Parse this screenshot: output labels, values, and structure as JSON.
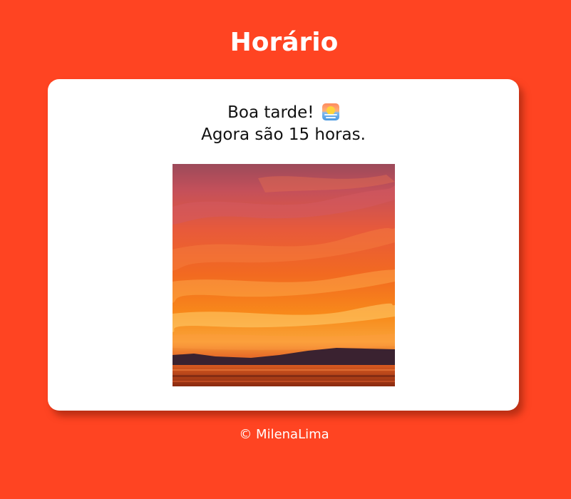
{
  "header": {
    "title": "Horário"
  },
  "card": {
    "greeting": "Boa tarde!",
    "greeting_icon": "sunrise-emoji-icon",
    "time_text": "Agora são 15 horas.",
    "image": "sunset-photo"
  },
  "footer": {
    "text": "© MilenaLima"
  },
  "colors": {
    "background": "#ff4422",
    "card": "#ffffff",
    "text": "#111111",
    "title": "#ffffff"
  }
}
